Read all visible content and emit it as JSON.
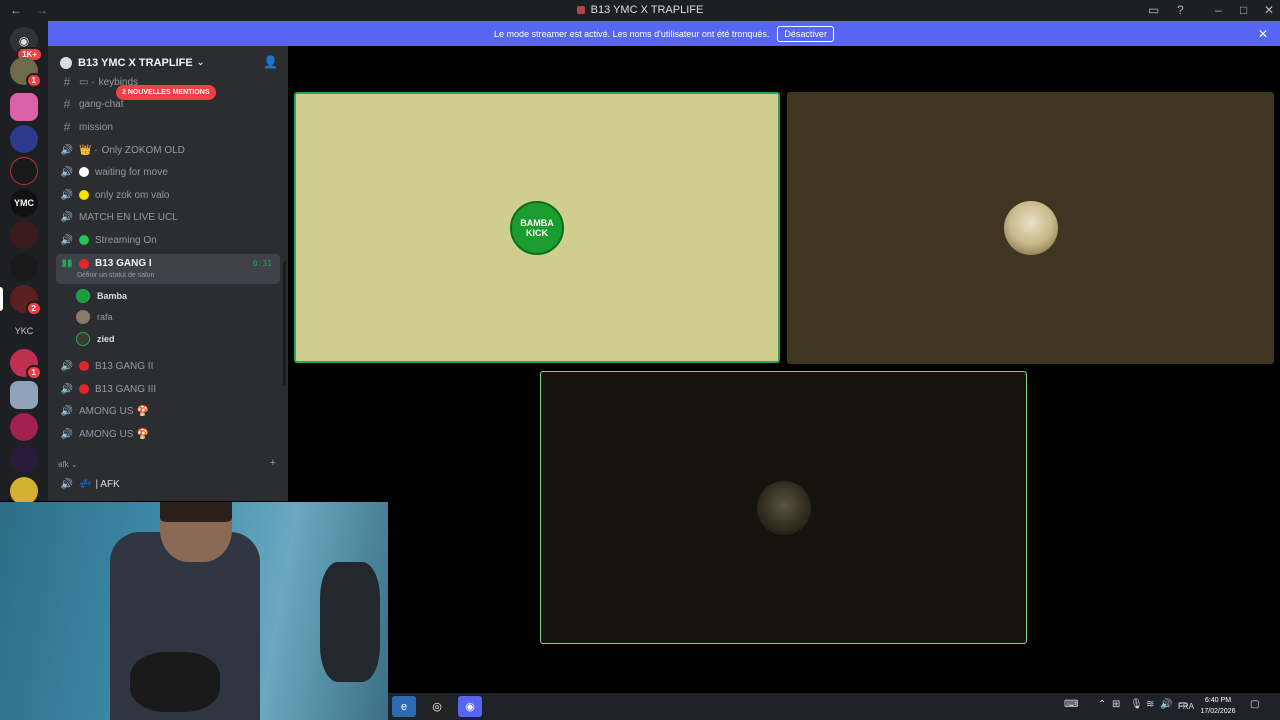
{
  "window": {
    "title": "B13 YMC X TRAPLIFE",
    "back_icon": "←",
    "forward_icon": "→"
  },
  "banner": {
    "text": "Le mode streamer est activé. Les noms d'utilisateur ont été tronqués.",
    "button": "Désactiver",
    "close": "✕"
  },
  "server_rail": {
    "top_badge": "1K+",
    "badges": [
      "1",
      "2",
      "1"
    ]
  },
  "sidebar": {
    "server_name": "B13 YMC X TRAPLIFE",
    "mentions_badge": "2 NOUVELLES MENTIONS",
    "channels": [
      {
        "type": "text",
        "label": "keybinds",
        "prefix": "▭ ·"
      },
      {
        "type": "text",
        "label": "gang-chat"
      },
      {
        "type": "text",
        "label": "mission"
      },
      {
        "type": "voice",
        "label": "Only ZOKOM OLD",
        "emoji": "👑 ·"
      },
      {
        "type": "voice",
        "label": "waiting for move",
        "emoji": "· "
      },
      {
        "type": "voice",
        "label": "only zok om valo",
        "emoji": "· "
      },
      {
        "type": "voice",
        "label": "MATCH EN LIVE UCL"
      },
      {
        "type": "voice",
        "label": "Streaming On",
        "emoji": "· "
      }
    ],
    "active_channel": {
      "label": "B13 GANG I",
      "time": "0:31",
      "subtitle": "Définir un statut de salon"
    },
    "voice_users": [
      {
        "name": "Bamba"
      },
      {
        "name": "rafa"
      },
      {
        "name": "zied"
      }
    ],
    "more_channels": [
      {
        "label": "B13 GANG II"
      },
      {
        "label": "B13 GANG III"
      },
      {
        "label": "AMONG US"
      },
      {
        "label": "AMONG US"
      }
    ],
    "category": "afk",
    "afk_channel": "AFK"
  },
  "stage": {
    "tiles": [
      {
        "name": "bamba-tile",
        "avatar_text": "BAMBA KICK"
      },
      {
        "name": "rafa-tile"
      },
      {
        "name": "zied-tile"
      }
    ]
  },
  "taskbar": {
    "language": "FRA",
    "time": "6:40 PM",
    "date": "17/02/2026"
  }
}
